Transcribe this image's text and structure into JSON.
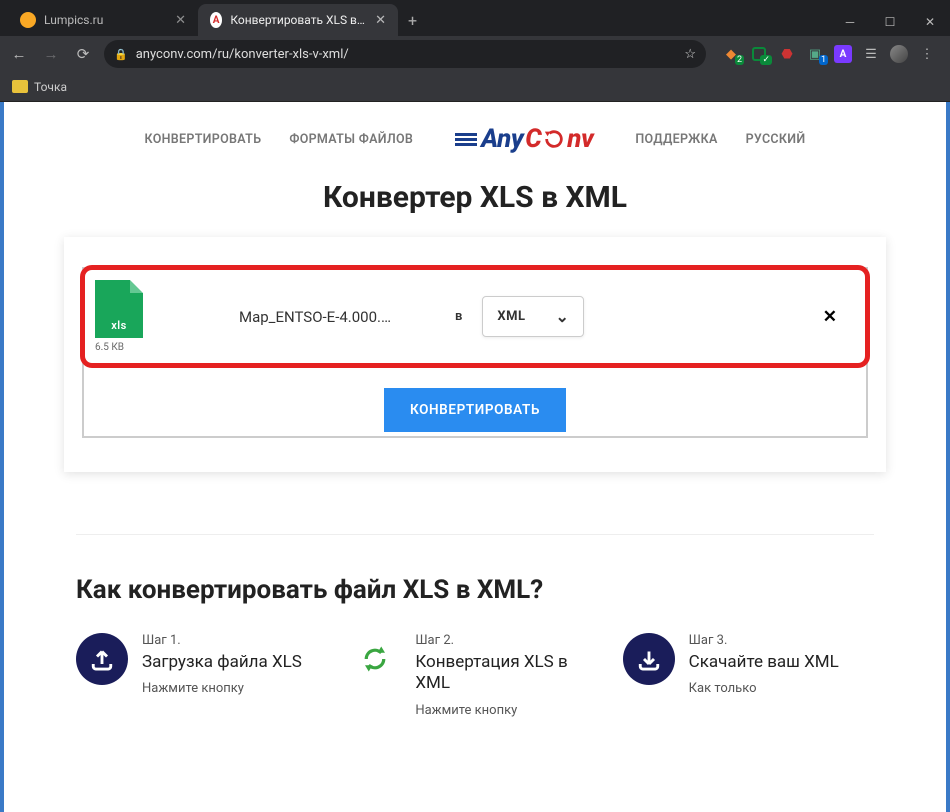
{
  "browser": {
    "tabs": [
      {
        "title": "Lumpics.ru"
      },
      {
        "title": "Конвертировать XLS в XML онл"
      }
    ],
    "url": "anyconv.com/ru/konverter-xls-v-xml/",
    "bookmark": "Точка"
  },
  "nav": {
    "item1": "КОНВЕРТИРОВАТЬ",
    "item2": "ФОРМАТЫ ФАЙЛОВ",
    "item3": "ПОДДЕРЖКА",
    "item4": "РУССКИЙ",
    "logo_a": "Any",
    "logo_b": "C",
    "logo_c": "nv"
  },
  "page_title": "Конвертер XLS в XML",
  "file": {
    "ext": "xls",
    "size": "6.5 КВ",
    "name": "Map_ENTSO-E-4.000.…",
    "to_label": "в",
    "target_format": "XML"
  },
  "convert_label": "КОНВЕРТИРОВАТЬ",
  "howto_title": "Как конвертировать файл XLS в XML?",
  "steps": {
    "s1": {
      "num": "Шаг 1.",
      "title": "Загрузка файла XLS",
      "desc": "Нажмите кнопку"
    },
    "s2": {
      "num": "Шаг 2.",
      "title": "Конвертация XLS в XML",
      "desc": "Нажмите кнопку"
    },
    "s3": {
      "num": "Шаг 3.",
      "title": "Скачайте ваш XML",
      "desc": "Как только"
    }
  }
}
